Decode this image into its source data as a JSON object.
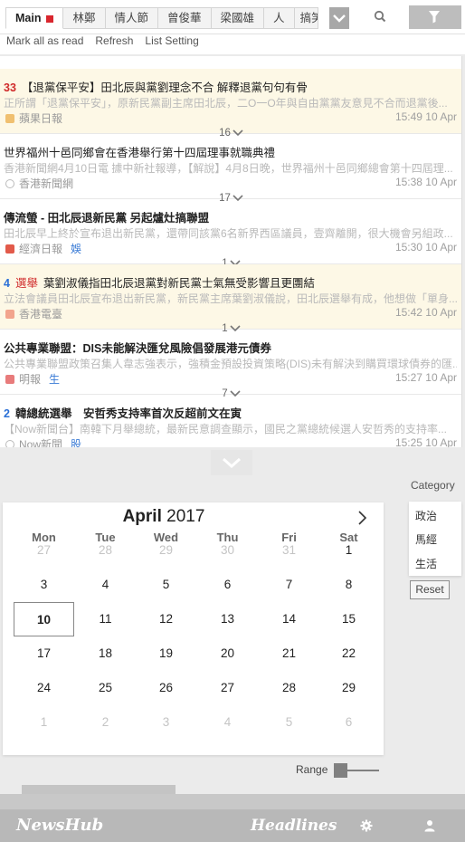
{
  "tabs": {
    "items": [
      "Main",
      "林鄭",
      "情人節",
      "曾俊華",
      "梁國雄",
      "人",
      "搞笑"
    ],
    "active_index": 0
  },
  "actions": {
    "mark_all": "Mark all as read",
    "refresh": "Refresh",
    "list_setting": "List Setting"
  },
  "news": [
    {
      "count": "33",
      "title": "【退黨保平安】田北辰與黨劉理念不合 解釋退黨句句有骨",
      "snippet": "正所謂「退黨保平安」，原新民黨副主席田北辰，二O一O年與自由黨黨友意見不合而退黨後...",
      "source": "蘋果日報",
      "time": "15:49 10 Apr",
      "highlight": true
    },
    {
      "count": "",
      "title": "世界福州十邑同鄉會在香港舉行第十四屆理事就職典禮",
      "snippet": "香港新聞網4月10日電 據中新社報導，【解說】4月8日晚，世界福州十邑同鄉總會第十四屆理...",
      "source": "香港新聞網",
      "time": "15:38 10 Apr",
      "sep": "16"
    },
    {
      "count": "",
      "title": "傳流螢 - 田北辰退新民黨 另起爐灶搞聯盟",
      "snippet": "田北辰早上終於宣布退出新民黨，還帶同該黨6名新界西區議員，壹齊離開，很大機會另組政...",
      "source": "經濟日報",
      "badge": "娛",
      "time": "15:30 10 Apr",
      "sep": "17"
    },
    {
      "count": "4",
      "tag": "選舉",
      "title": "葉劉淑儀指田北辰退黨對新民黨士氣無受影響且更團結",
      "snippet": "立法會議員田北辰宣布退出新民黨，新民黨主席葉劉淑儀說，田北辰選舉有成，他想做「單身...",
      "source": "香港電臺",
      "time": "15:42 10 Apr",
      "sep": "1",
      "highlight": true
    },
    {
      "count": "",
      "title": "公共專業聯盟：DIS未能解決匯兌風險倡發展港元債券",
      "snippet": "公共專業聯盟政策召集人韋志強表示，強積金預設投資策略(DIS)未有解決到購買環球債券的匯...",
      "source": "明報",
      "badge": "生",
      "time": "15:27 10 Apr",
      "sep": "1"
    },
    {
      "count": "2",
      "title": "韓總統選舉　安哲秀支持率首次反超前文在寅",
      "snippet": "【Now新聞台】南韓下月舉總統，最新民意調查顯示，國民之黨總統候選人安哲秀的支持率...",
      "source": "Now新聞",
      "badge": "股",
      "time": "15:25 10 Apr",
      "sep": "7"
    }
  ],
  "calendar": {
    "month": "April",
    "year": "2017",
    "weekdays": [
      "Mon",
      "Tue",
      "Wed",
      "Thu",
      "Fri",
      "Sat"
    ],
    "weeks": [
      [
        "27",
        "28",
        "29",
        "30",
        "31",
        "1"
      ],
      [
        "3",
        "4",
        "5",
        "6",
        "7",
        "8"
      ],
      [
        "10",
        "11",
        "12",
        "13",
        "14",
        "15"
      ],
      [
        "17",
        "18",
        "19",
        "20",
        "21",
        "22"
      ],
      [
        "24",
        "25",
        "26",
        "27",
        "28",
        "29"
      ],
      [
        "1",
        "2",
        "3",
        "4",
        "5",
        "6"
      ]
    ],
    "today": "10"
  },
  "category": {
    "label": "Category",
    "options": [
      "政治",
      "馬經",
      "生活"
    ],
    "reset": "Reset"
  },
  "range_label": "Range",
  "footer": {
    "brand": "NewsHub",
    "headlines": "Headlines"
  },
  "colors": {
    "accent_red": "#d02b2b",
    "accent_blue": "#2a6fd6",
    "highlight_bg": "#fdf8e6",
    "footer_bg": "#b8b8b8"
  }
}
